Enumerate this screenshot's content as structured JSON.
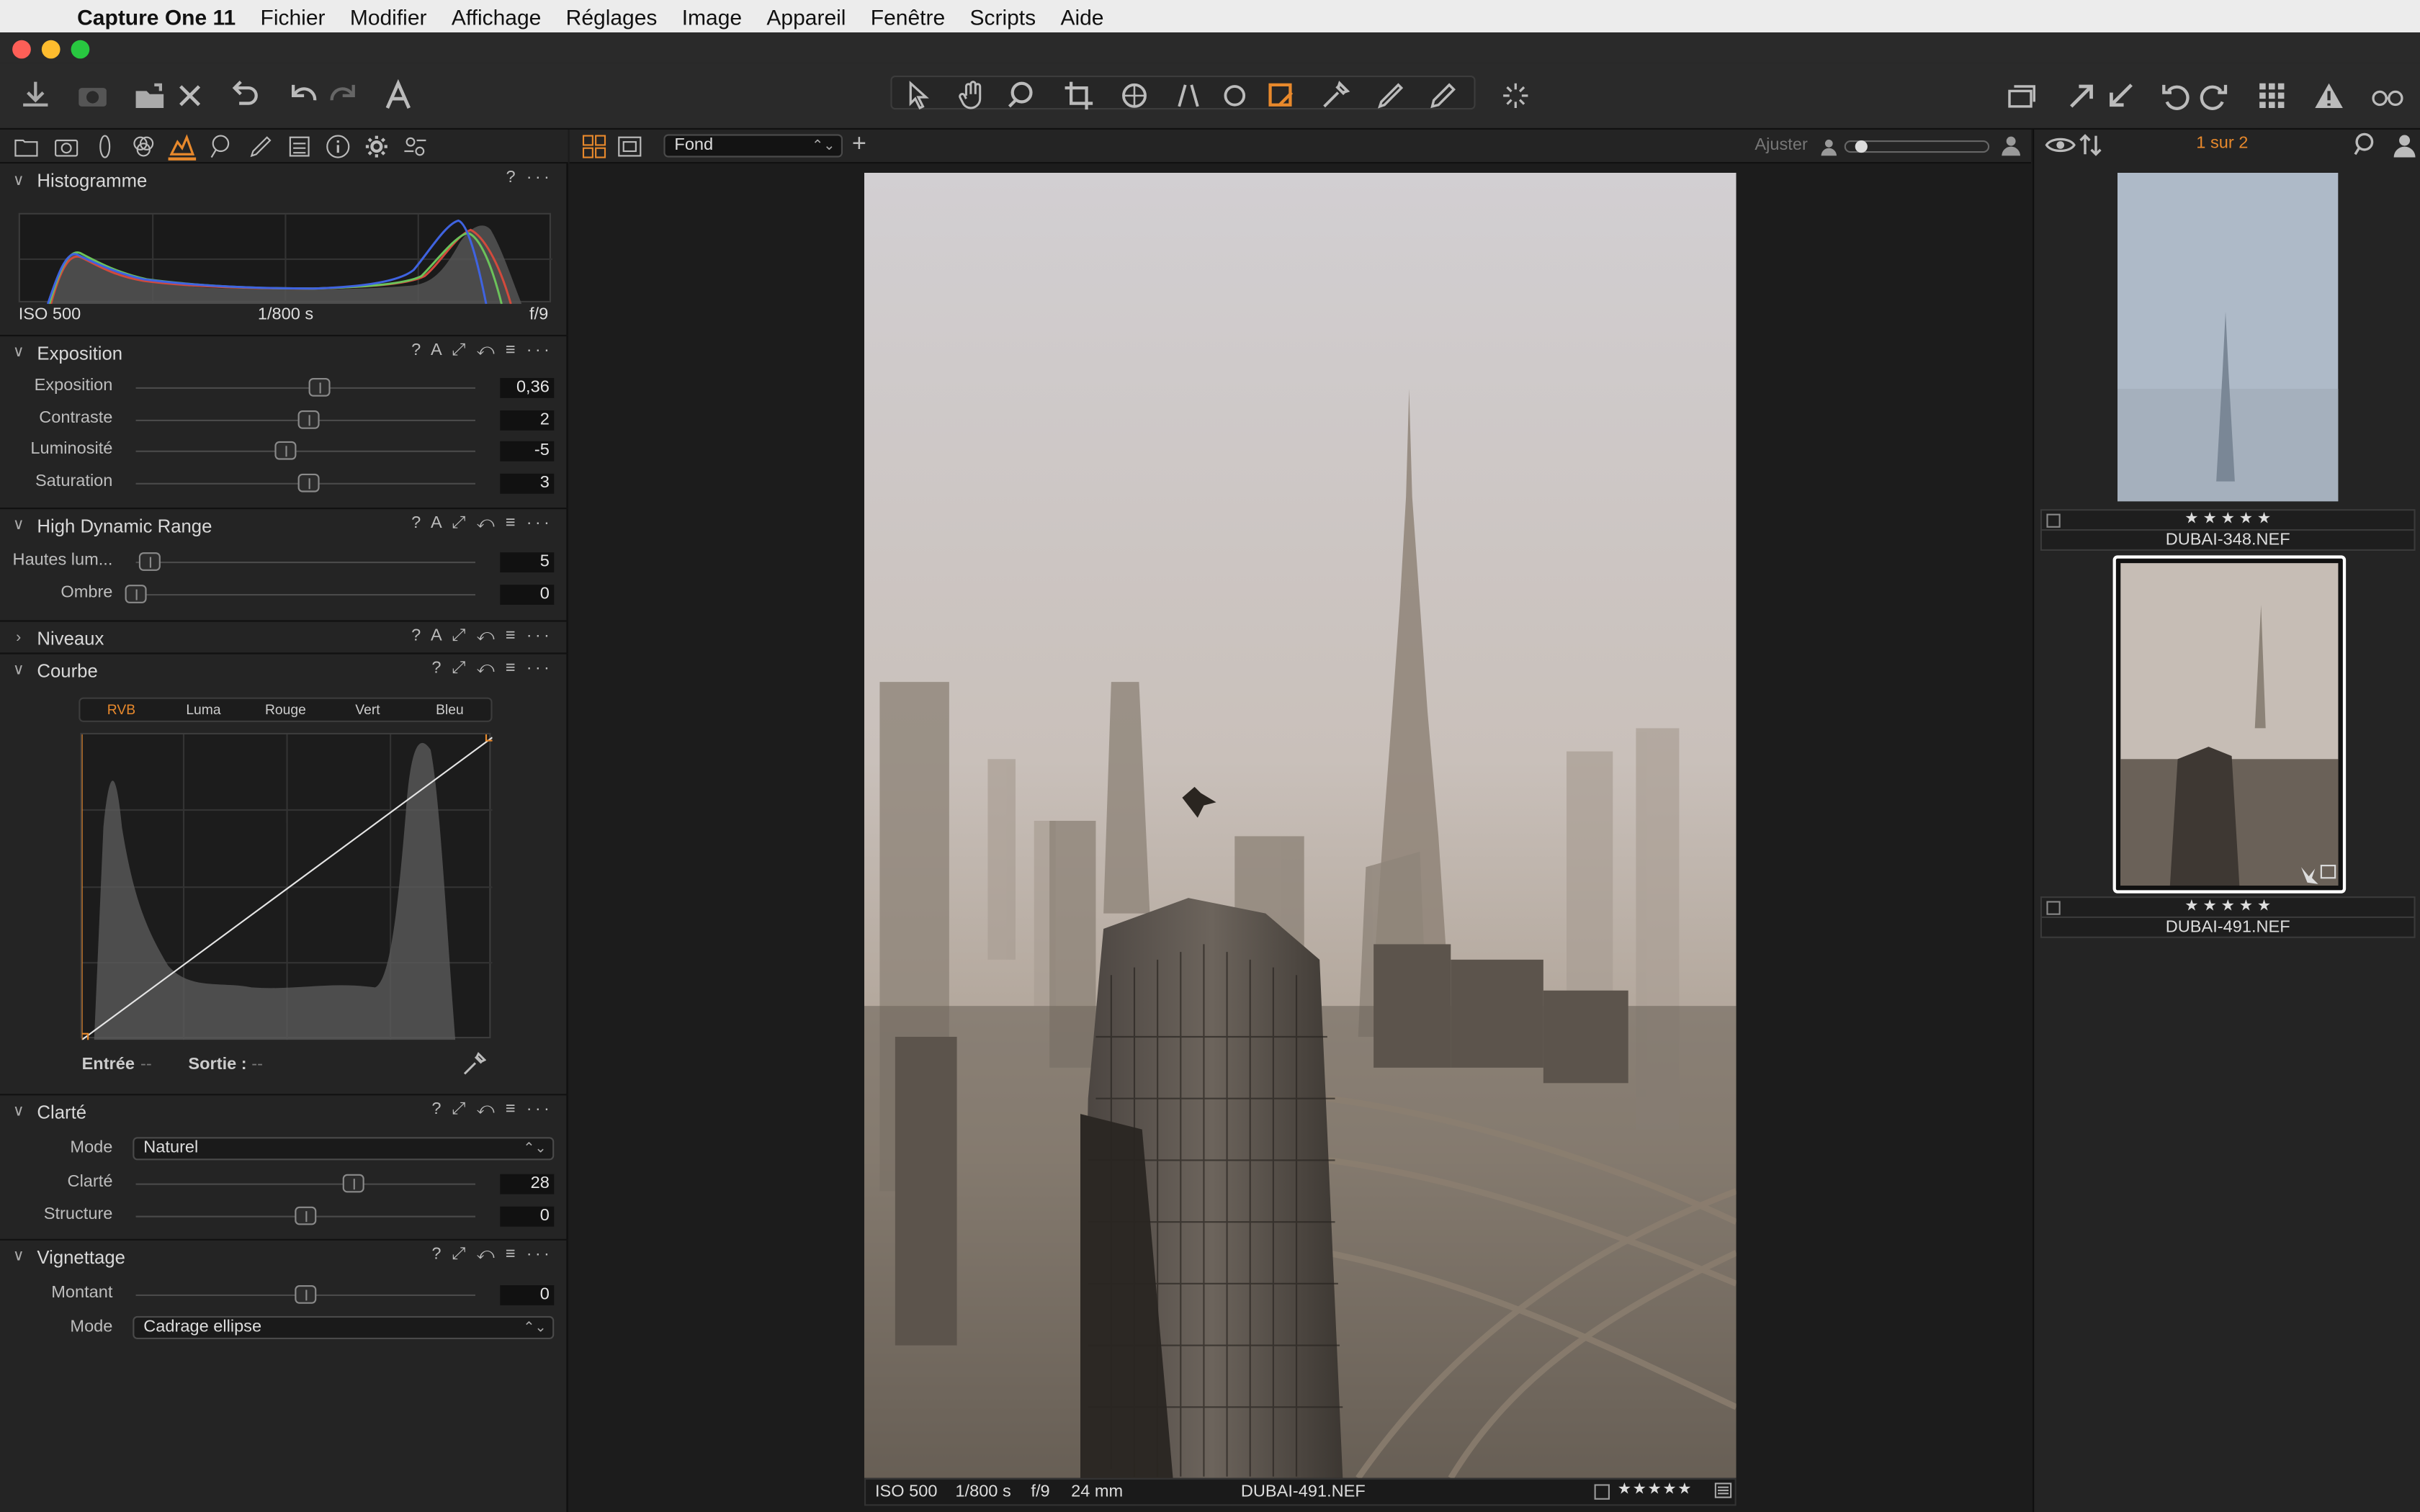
{
  "menubar": {
    "app_name": "Capture One 11",
    "items": [
      "Fichier",
      "Modifier",
      "Affichage",
      "Réglages",
      "Image",
      "Appareil",
      "Fenêtre",
      "Scripts",
      "Aide"
    ]
  },
  "viewer_bar": {
    "layer_select": "Fond",
    "adjust_label": "Ajuster"
  },
  "histogram": {
    "title": "Histogramme",
    "iso": "ISO 500",
    "shutter": "1/800 s",
    "aperture": "f/9"
  },
  "exposure": {
    "title": "Exposition",
    "sliders": [
      {
        "label": "Exposition",
        "value": "0,36",
        "level": 0.54
      },
      {
        "label": "Contraste",
        "value": "2",
        "level": 0.51
      },
      {
        "label": "Luminosité",
        "value": "-5",
        "level": 0.44
      },
      {
        "label": "Saturation",
        "value": "3",
        "level": 0.51
      }
    ]
  },
  "hdr": {
    "title": "High Dynamic Range",
    "sliders": [
      {
        "label": "Hautes lum...",
        "value": "5",
        "level": 0.04
      },
      {
        "label": "Ombre",
        "value": "0",
        "level": 0.0
      }
    ]
  },
  "levels": {
    "title": "Niveaux"
  },
  "curve": {
    "title": "Courbe",
    "tabs": [
      "RVB",
      "Luma",
      "Rouge",
      "Vert",
      "Bleu"
    ],
    "active_tab": "RVB",
    "input_label": "Entrée",
    "input_value": "--",
    "output_label": "Sortie :",
    "output_value": "--"
  },
  "clarity": {
    "title": "Clarté",
    "mode_label": "Mode",
    "mode_value": "Naturel",
    "sliders": [
      {
        "label": "Clarté",
        "value": "28",
        "level": 0.64
      },
      {
        "label": "Structure",
        "value": "0",
        "level": 0.5
      }
    ]
  },
  "vignette": {
    "title": "Vignettage",
    "sliders": [
      {
        "label": "Montant",
        "value": "0",
        "level": 0.5
      }
    ],
    "mode_label": "Mode",
    "mode_value": "Cadrage ellipse"
  },
  "browser": {
    "counter": "1 sur 2",
    "items": [
      {
        "name": "DUBAI-348.NEF",
        "stars": "★ ★ ★ ★ ★"
      },
      {
        "name": "DUBAI-491.NEF",
        "stars": "★ ★ ★ ★ ★"
      }
    ]
  },
  "infobar": {
    "iso": "ISO 500",
    "shutter": "1/800 s",
    "aperture": "f/9",
    "focal": "24 mm",
    "filename": "DUBAI-491.NEF",
    "stars": "★ ★ ★ ★ ★"
  },
  "colors": {
    "accent": "#e8892c",
    "panel": "#242424",
    "histogram_red": "#d24a3c",
    "histogram_green": "#6bc25a",
    "histogram_blue": "#3f63e0"
  }
}
